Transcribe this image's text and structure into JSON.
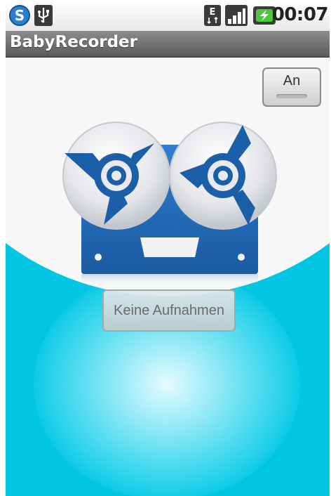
{
  "status_bar": {
    "time": "00:07",
    "icons": [
      "sync-icon",
      "usb-icon",
      "network-e-icon",
      "signal-icon",
      "battery-charging-icon"
    ]
  },
  "app": {
    "title": "BabyRecorder"
  },
  "controls": {
    "toggle_label": "An",
    "recordings_label": "Keine Aufnahmen"
  },
  "colors": {
    "accent_blue": "#1b5fa8",
    "background_cyan": "#00c6e4",
    "title_bar": "#6e6e6e"
  }
}
